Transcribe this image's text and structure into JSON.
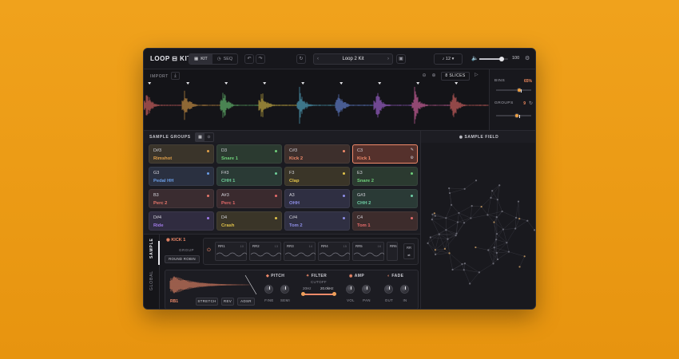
{
  "app": {
    "logo": "LOOP ⊟ KIT",
    "mode_tabs": [
      {
        "label": "KIT",
        "icon": "grid-icon",
        "active": true
      },
      {
        "label": "SEQ",
        "icon": "clock-icon",
        "active": false
      }
    ],
    "kit_name": "Loop 2 Kit",
    "tempo": "12",
    "volume": {
      "value": "100",
      "level": 0.78
    }
  },
  "waveform": {
    "import_label": "IMPORT",
    "slices_label": "8 SLICES",
    "slice_colors": [
      "#e66b6b",
      "#e0a04a",
      "#6fcf7a",
      "#e0c24a",
      "#59b8d8",
      "#6b8ee6",
      "#b06be6",
      "#e66bb0",
      "#e66b6b"
    ]
  },
  "side_controls": {
    "bins_label": "BINS",
    "bins_value": "65%",
    "bins_level": 0.65,
    "groups_label": "GROUPS",
    "groups_value": "9",
    "groups_level": 0.6
  },
  "sample_groups": {
    "title": "SAMPLE GROUPS",
    "field_title": "SAMPLE FIELD",
    "pads": [
      {
        "note": "D#3",
        "name": "Rimshot",
        "color": "#e0a04a",
        "bg": "#3a342a"
      },
      {
        "note": "D3",
        "name": "Snare 1",
        "color": "#6fcf7a",
        "bg": "#2b3a30"
      },
      {
        "note": "C#3",
        "name": "Kick 2",
        "color": "#f08a6a",
        "bg": "#3d2f2c"
      },
      {
        "note": "C3",
        "name": "Kick 1",
        "color": "#f08a6a",
        "bg": "#55312c",
        "selected": true
      },
      {
        "note": "G3",
        "name": "Pedal HH",
        "color": "#6b9ee6",
        "bg": "#2a3040"
      },
      {
        "note": "F#3",
        "name": "CHH 1",
        "color": "#6fcf9a",
        "bg": "#2a3a35"
      },
      {
        "note": "F3",
        "name": "Clap",
        "color": "#e0c24a",
        "bg": "#3a3528"
      },
      {
        "note": "E3",
        "name": "Snare 2",
        "color": "#6fcf7a",
        "bg": "#2b3a30"
      },
      {
        "note": "B3",
        "name": "Perc 2",
        "color": "#e6766b",
        "bg": "#3a2c30"
      },
      {
        "note": "A#3",
        "name": "Perc 1",
        "color": "#e66b6b",
        "bg": "#3a2a2e"
      },
      {
        "note": "A3",
        "name": "OHH",
        "color": "#8e8ee6",
        "bg": "#2f2f42"
      },
      {
        "note": "G#3",
        "name": "CHH 2",
        "color": "#6fcfa6",
        "bg": "#2a3a36"
      },
      {
        "note": "D#4",
        "name": "Ride",
        "color": "#a07ae6",
        "bg": "#302c40"
      },
      {
        "note": "D4",
        "name": "Crash",
        "color": "#e0c24a",
        "bg": "#3a3528"
      },
      {
        "note": "C#4",
        "name": "Tom 2",
        "color": "#8e8ee6",
        "bg": "#2f2f42"
      },
      {
        "note": "C4",
        "name": "Tom 1",
        "color": "#e66b6b",
        "bg": "#3d2c2c"
      }
    ]
  },
  "lower": {
    "tabs": [
      "SAMPLE",
      "GLOBAL"
    ],
    "sample_title": "KICK 1",
    "group_label": "GROUP",
    "group_mode": "ROUND ROBIN",
    "rr_cells": [
      {
        "label": "RR1",
        "num": "10"
      },
      {
        "label": "RR2",
        "num": "13"
      },
      {
        "label": "RR3",
        "num": "14"
      },
      {
        "label": "RR4",
        "num": "15"
      },
      {
        "label": "RR5",
        "num": "16"
      },
      {
        "label": "RR6",
        "num": ""
      }
    ],
    "rr_end": "RR",
    "rr_current": "RB1",
    "wave_buttons": [
      "STRETCH",
      "REV",
      "ADSR"
    ],
    "modules": {
      "pitch": {
        "title": "PITCH",
        "knobs": [
          "FINE",
          "SEMI"
        ]
      },
      "filter": {
        "title": "FILTER",
        "cutoff_label": "CUTOFF",
        "lo": "20Hz",
        "hi": "20.0kHz"
      },
      "amp": {
        "title": "AMP",
        "knobs": [
          "VOL",
          "PAN"
        ]
      },
      "fade": {
        "title": "FADE",
        "knobs": [
          "OUT",
          "IN"
        ]
      }
    }
  }
}
